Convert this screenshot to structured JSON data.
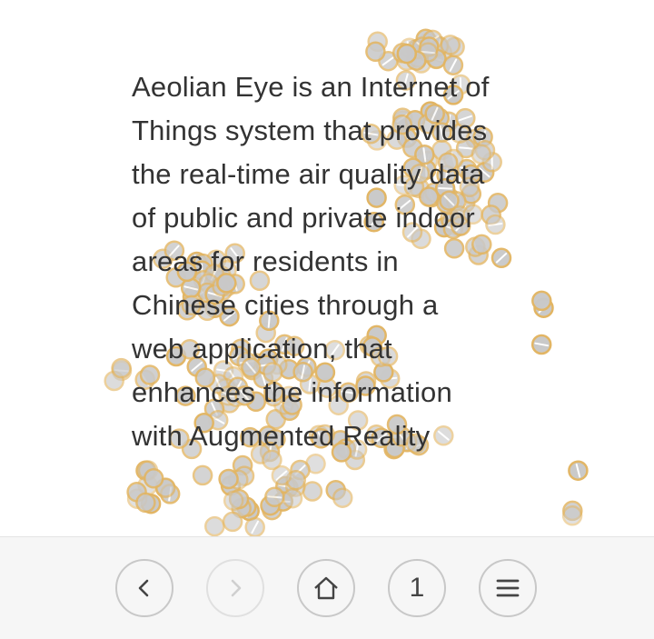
{
  "page": {
    "description_lines": [
      "Aeolian Eye is an Internet of",
      "Things system that provides",
      "the real-time air quality data",
      "of public and private indoor",
      "areas for residents in",
      "Chinese cities through a",
      "web application, that",
      "enhances the information",
      "with Augmented Reality"
    ]
  },
  "toolbar": {
    "back_icon": "chevron-left-icon",
    "forward_icon": "chevron-right-icon",
    "home_icon": "home-icon",
    "tab_count": "1",
    "menu_icon": "hamburger-menu-icon"
  },
  "colors": {
    "text": "#333333",
    "particle_fill": "#c9c9c9",
    "particle_ring": "#e2b563",
    "toolbar_bg": "#f6f6f6",
    "button_border": "#c8c8c8"
  }
}
